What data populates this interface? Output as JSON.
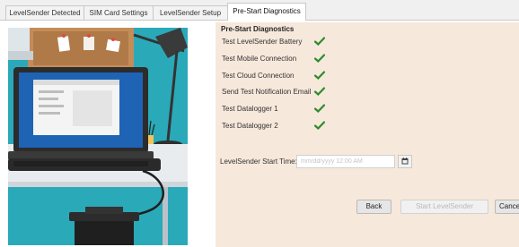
{
  "tabs": [
    {
      "label": "LevelSender Detected",
      "active": false
    },
    {
      "label": "SIM Card Settings",
      "active": false
    },
    {
      "label": "LevelSender Setup",
      "active": false
    },
    {
      "label": "Pre-Start Diagnostics",
      "active": true
    }
  ],
  "diagnostics": {
    "title": "Pre-Start Diagnostics",
    "tests": [
      {
        "label": "Test LevelSender Battery",
        "status": "passed",
        "icon": "checkmark-icon"
      },
      {
        "label": "Test Mobile Connection",
        "status": "passed",
        "icon": "checkmark-icon"
      },
      {
        "label": "Test Cloud Connection",
        "status": "passed",
        "icon": "checkmark-icon"
      },
      {
        "label": "Send Test Notification Email",
        "status": "passed",
        "icon": "checkmark-icon"
      },
      {
        "label": "Test Datalogger 1",
        "status": "passed",
        "icon": "checkmark-icon"
      },
      {
        "label": "Test Datalogger 2",
        "status": "passed",
        "icon": "checkmark-icon"
      }
    ],
    "check_color": "#2e8b2e"
  },
  "start_time": {
    "label": "LevelSender Start Time:",
    "placeholder": "mm/dd/yyyy 12:00 AM",
    "calendar_icon": "calendar-icon"
  },
  "buttons": {
    "back": "Back",
    "start": "Start LevelSender",
    "cancel": "Cancel"
  },
  "colors": {
    "panel_background": "#f7e8dc",
    "wall": "#2aa9b9",
    "cork_board": "#c48c58"
  }
}
